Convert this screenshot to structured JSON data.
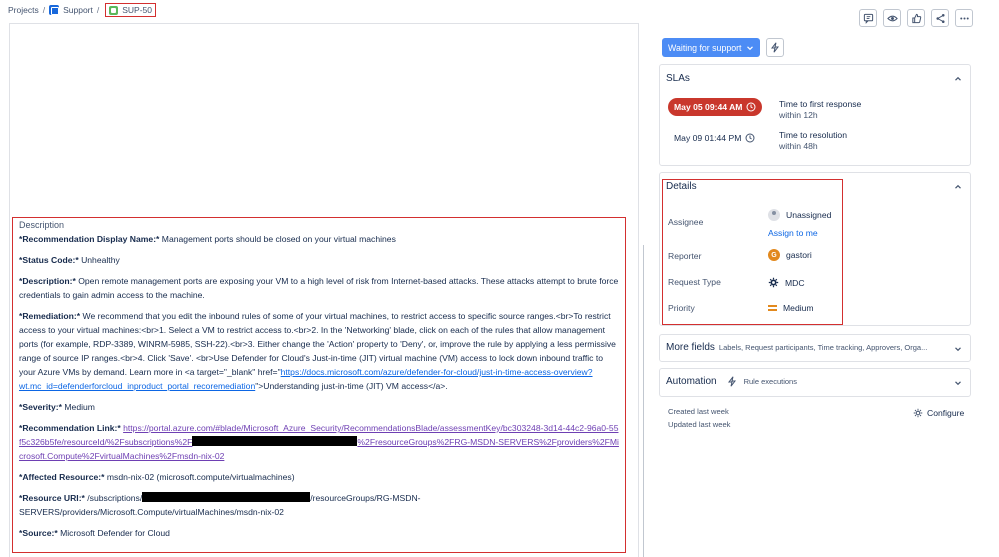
{
  "breadcrumb": {
    "projects": "Projects",
    "sep": "/",
    "project": "Support",
    "issue_key": "SUP-50"
  },
  "status": {
    "label": "Waiting for support"
  },
  "slas": {
    "title": "SLAs",
    "items": [
      {
        "time": "May 05 09:44 AM",
        "name": "Time to first response",
        "target": "within 12h",
        "state": "breached"
      },
      {
        "time": "May 09 01:44 PM",
        "name": "Time to resolution",
        "target": "within 48h",
        "state": "running"
      }
    ]
  },
  "details": {
    "title": "Details",
    "assignee_label": "Assignee",
    "assignee_value": "Unassigned",
    "assign_to_me": "Assign to me",
    "reporter_label": "Reporter",
    "reporter_value": "gastori",
    "reporter_initial": "G",
    "request_type_label": "Request Type",
    "request_type_value": "MDC",
    "priority_label": "Priority",
    "priority_value": "Medium"
  },
  "more_fields": {
    "title": "More fields",
    "subtitle": "Labels, Request participants, Time tracking, Approvers, Orga..."
  },
  "automation": {
    "title": "Automation",
    "subtitle": "Rule executions"
  },
  "meta": {
    "created": "Created last week",
    "updated": "Updated last week",
    "configure": "Configure"
  },
  "description": {
    "title": "Description",
    "rec_name_label": "*Recommendation Display Name:*",
    "rec_name_value": " Management ports should be closed on your virtual machines",
    "status_label": "*Status Code:*",
    "status_value": " Unhealthy",
    "desc_label": "*Description:*",
    "desc_value": " Open remote management ports are exposing your VM to a high level of risk from Internet-based attacks. These attacks attempt to brute force credentials to gain admin access to the machine.",
    "rem_label": "*Remediation:*",
    "rem_value": " We recommend that you edit the inbound rules of some of your virtual machines, to restrict access to specific source ranges.<br>To restrict access to your virtual machines:<br>1. Select a VM to restrict access to.<br>2. In the 'Networking' blade, click on each of the rules that allow management ports (for example, RDP-3389, WINRM-5985, SSH-22).<br>3. Either change the 'Action' property to 'Deny', or, improve the rule by applying a less permissive range of source IP ranges.<br>4. Click 'Save'. <br>Use Defender for Cloud's Just-in-time (JIT) virtual machine (VM) access to lock down inbound traffic to your Azure VMs by demand. Learn more in <a target=\"_blank\" href=\"",
    "rem_link": "https://docs.microsoft.com/azure/defender-for-cloud/just-in-time-access-overview?wt.mc_id=defenderforcloud_inproduct_portal_recoremediation",
    "rem_tail": "\">Understanding just-in-time (JIT) VM access</a>.",
    "sev_label": "*Severity:*",
    "sev_value": " Medium",
    "link_label": "*Recommendation Link:*",
    "link_a": "https://portal.azure.com/#blade/Microsoft_Azure_Security/RecommendationsBlade/assessmentKey/bc303248-3d14-44c2-96a0-55f5c326b5fe/resourceId/%2Fsubscriptions%2F",
    "link_b": "%2FresourceGroups%2FRG-MSDN-SERVERS%2Fproviders%2FMicrosoft.Compute%2FvirtualMachines%2Fmsdn-nix-02",
    "res_label": "*Affected Resource:*",
    "res_value": " msdn-nix-02 (microsoft.compute/virtualmachines)",
    "uri_label": "*Resource URI:*",
    "uri_a": " /subscriptions/",
    "uri_b": "/resourceGroups/RG-MSDN-SERVERS/providers/Microsoft.Compute/virtualMachines/msdn-nix-02",
    "source_label": "*Source:*",
    "source_value": " Microsoft Defender for Cloud"
  }
}
